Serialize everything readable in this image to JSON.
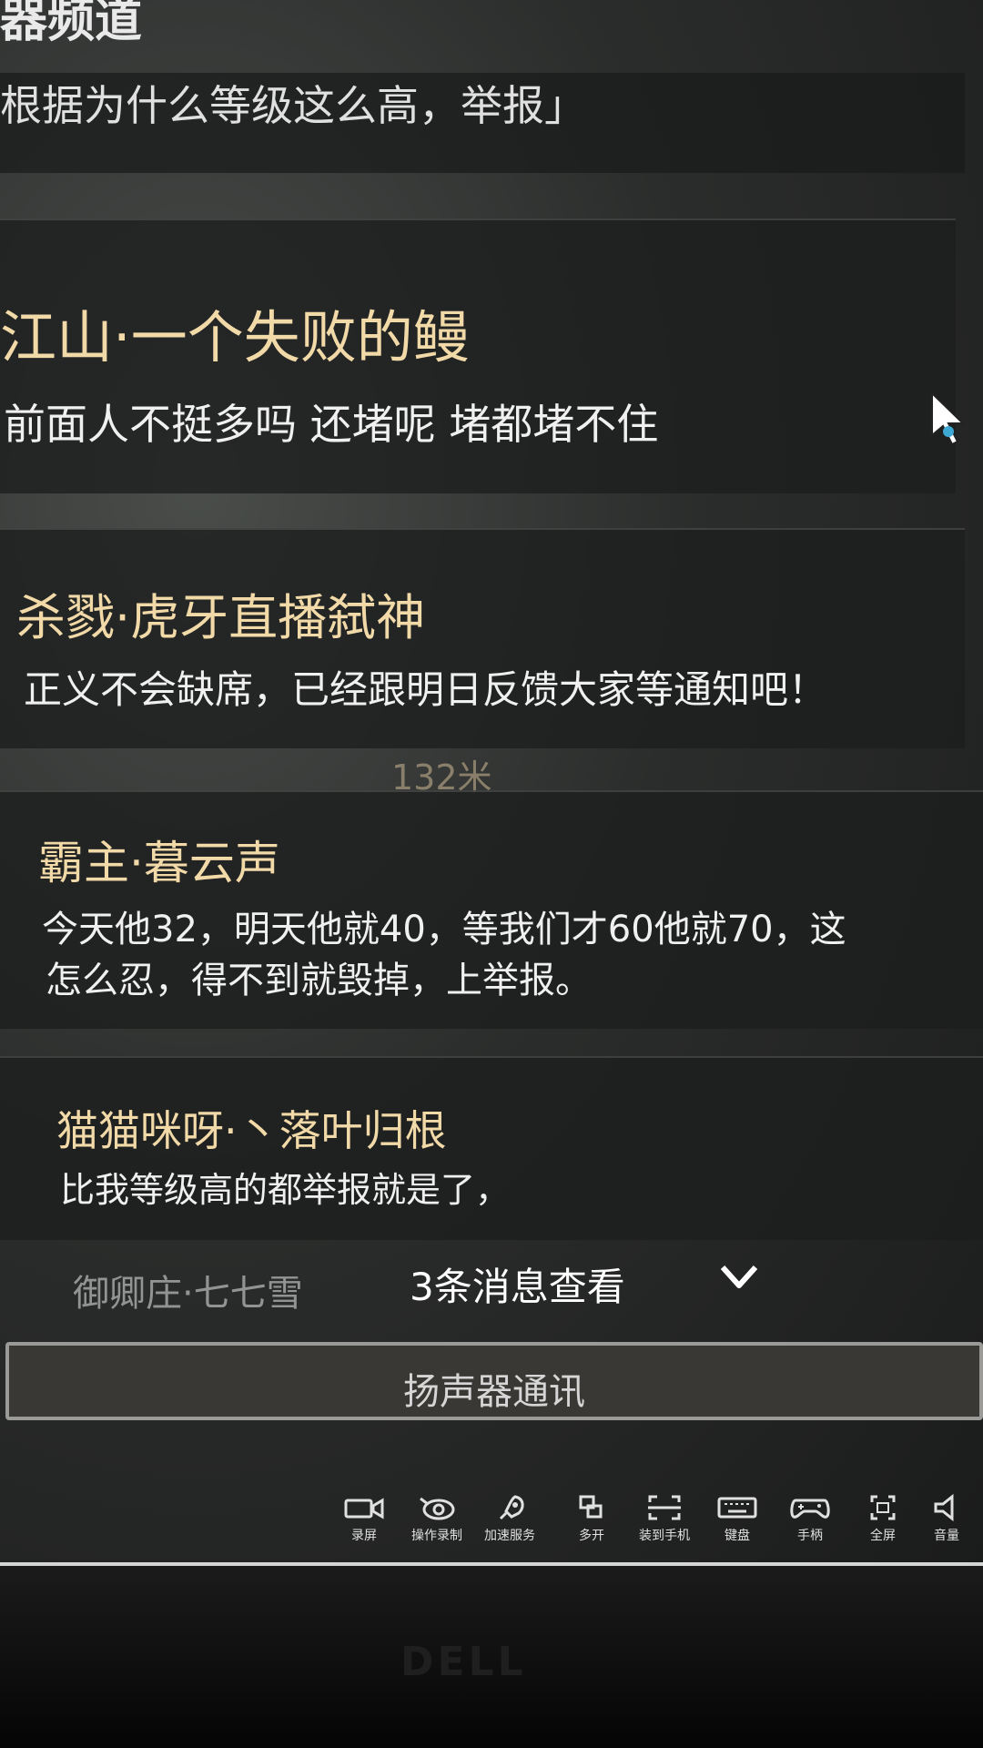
{
  "header": {
    "title_fragment": "器频道",
    "cut_message": "根据为什么等级这么高，举报」"
  },
  "messages": [
    {
      "name": "江山·一个失败的鳗",
      "text": "前面人不挺多吗 还堵呢 堵都堵不住"
    },
    {
      "name": "杀戮·虎牙直播弑神",
      "text": "正义不会缺席，已经跟明日反馈大家等通知吧！"
    },
    {
      "name": "霸主·暮云声",
      "text_line1": "今天他32，明天他就40，等我们才60他就70，这",
      "text_line2": "怎么忍，得不到就毁掉，上举报。"
    },
    {
      "name": "猫猫咪呀·丶落叶归根",
      "text": "比我等级高的都举报就是了，"
    }
  ],
  "distance_label": "132米",
  "more": {
    "partial_name": "御卿庄·七七雪",
    "label": "3条消息查看"
  },
  "speaker_button": "扬声器通讯",
  "toolbar": [
    {
      "icon": "video-camera-icon",
      "label": "录屏"
    },
    {
      "icon": "eye-record-icon",
      "label": "操作录制"
    },
    {
      "icon": "rocket-icon",
      "label": "加速服务"
    },
    {
      "icon": "multi-window-icon",
      "label": "多开"
    },
    {
      "icon": "scan-phone-icon",
      "label": "装到手机"
    },
    {
      "icon": "keyboard-icon",
      "label": "键盘"
    },
    {
      "icon": "gamepad-icon",
      "label": "手柄"
    },
    {
      "icon": "fullscreen-icon",
      "label": "全屏"
    },
    {
      "icon": "volume-icon",
      "label": "音量"
    }
  ],
  "bezel_brand": "DELL",
  "colors": {
    "name_color": "#f2d9a8",
    "message_color": "#f0f0f0",
    "card_bg": "#1c1d1e"
  }
}
